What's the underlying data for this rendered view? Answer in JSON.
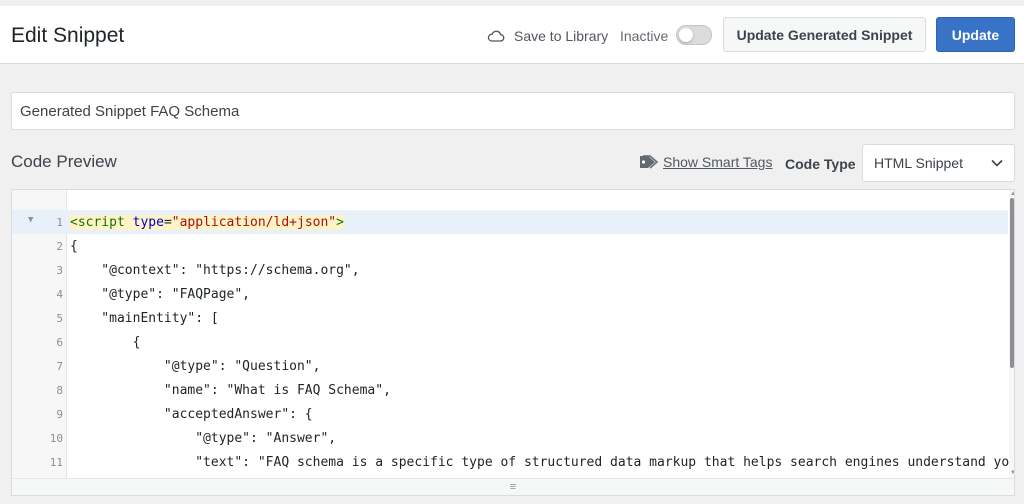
{
  "header": {
    "title": "Edit Snippet",
    "save_to_library": "Save to Library",
    "status_label": "Inactive",
    "active": false,
    "update_generated_label": "Update Generated Snippet",
    "update_label": "Update"
  },
  "snippet": {
    "title_value": "Generated Snippet FAQ Schema"
  },
  "code_preview": {
    "heading": "Code Preview",
    "smart_tags_label": "Show Smart Tags",
    "code_type_label": "Code Type",
    "code_type_value": "HTML Snippet"
  },
  "colors": {
    "primary_button": "#3873c7",
    "active_line": "#e8f0fa"
  },
  "code": {
    "line_numbers": [
      "1",
      "2",
      "3",
      "4",
      "5",
      "6",
      "7",
      "8",
      "9",
      "10",
      "11"
    ],
    "line1": {
      "open": "<",
      "tag": "script",
      "space": " ",
      "attr": "type",
      "eq": "=",
      "value": "\"application/ld+json\"",
      "close": ">"
    },
    "lines": [
      "{",
      "    \"@context\": \"https://schema.org\",",
      "    \"@type\": \"FAQPage\",",
      "    \"mainEntity\": [",
      "        {",
      "            \"@type\": \"Question\",",
      "            \"name\": \"What is FAQ Schema\",",
      "            \"acceptedAnswer\": {",
      "                \"@type\": \"Answer\",",
      "                \"text\": \"FAQ schema is a specific type of structured data markup that helps search engines understand your"
    ]
  }
}
